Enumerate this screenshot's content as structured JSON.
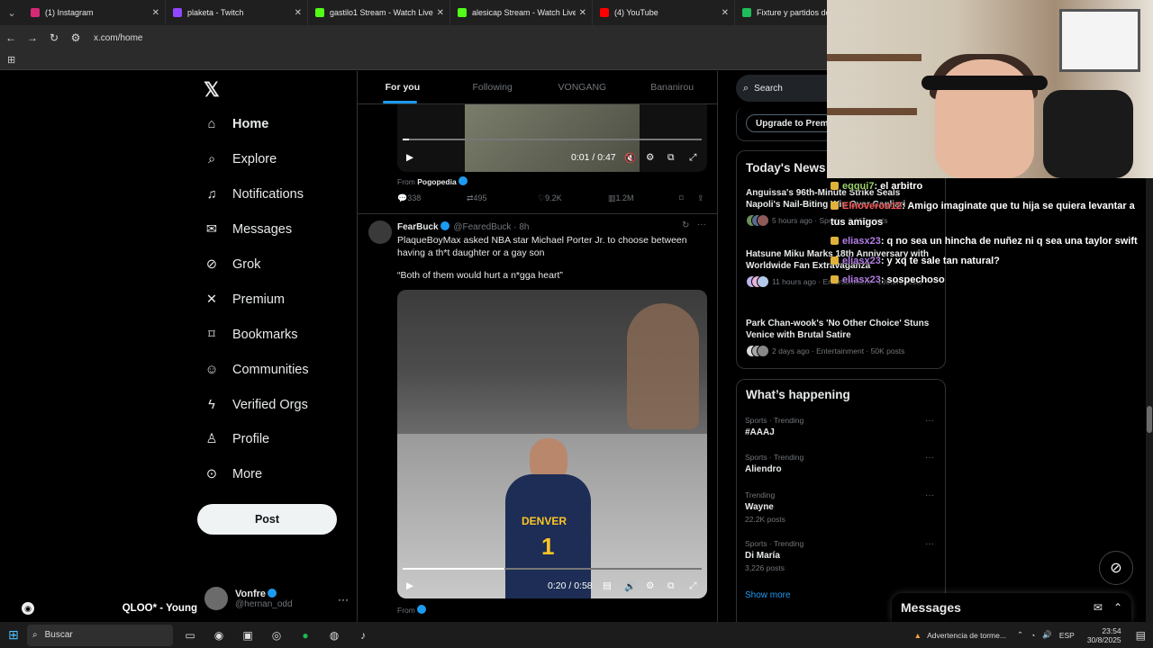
{
  "browser": {
    "tabs": [
      {
        "title": "(1) Instagram",
        "color": "#d62976"
      },
      {
        "title": "plaketa - Twitch",
        "color": "#9146ff"
      },
      {
        "title": "gastilo1 Stream - Watch Live o",
        "color": "#53fc18"
      },
      {
        "title": "alesicap Stream - Watch Live o",
        "color": "#53fc18"
      },
      {
        "title": "(4) YouTube",
        "color": "#ff0000"
      },
      {
        "title": "Fixture y partidos de m",
        "color": "#1fbe5a"
      }
    ],
    "url": "x.com/home"
  },
  "nav": {
    "items": [
      {
        "label": "Home",
        "icon": "home-icon",
        "glyph": "⌂"
      },
      {
        "label": "Explore",
        "icon": "search-icon",
        "glyph": "⌕"
      },
      {
        "label": "Notifications",
        "icon": "bell-icon",
        "glyph": "♫"
      },
      {
        "label": "Messages",
        "icon": "envelope-icon",
        "glyph": "✉"
      },
      {
        "label": "Grok",
        "icon": "grok-icon",
        "glyph": "⊘"
      },
      {
        "label": "Premium",
        "icon": "x-logo-icon",
        "glyph": "✕"
      },
      {
        "label": "Bookmarks",
        "icon": "bookmark-icon",
        "glyph": "⌑"
      },
      {
        "label": "Communities",
        "icon": "people-icon",
        "glyph": "☺"
      },
      {
        "label": "Verified Orgs",
        "icon": "lightning-icon",
        "glyph": "ϟ"
      },
      {
        "label": "Profile",
        "icon": "person-icon",
        "glyph": "♙"
      },
      {
        "label": "More",
        "icon": "more-circle-icon",
        "glyph": "⊙"
      }
    ],
    "post_label": "Post",
    "account": {
      "name": "Vonfre",
      "handle": "@hernan_odd"
    }
  },
  "music": {
    "text": "QLOO* - Young"
  },
  "timeline": {
    "tabs": [
      "For you",
      "Following",
      "VONGANG",
      "Bananirou"
    ],
    "post1": {
      "time": "0:01 / 0:47",
      "progress": 0.02,
      "from_label": "From",
      "from_name": "Pogopedia",
      "stats": {
        "replies": "338",
        "reposts": "495",
        "likes": "9.2K",
        "views": "1.2M"
      }
    },
    "post2": {
      "name": "FearBuck",
      "handle": "@FearedBuck",
      "time": "· 8h",
      "text": "PlaqueBoyMax asked NBA star Michael Porter Jr. to choose between having a th*t daughter or a gay son",
      "quote": "“Both of them would hurt a n*gga heart”",
      "jersey_text": "DENVER",
      "jersey_number": "1",
      "video_time": "0:20 / 0:58",
      "progress": 0.34,
      "from_label": "From"
    }
  },
  "sidebar": {
    "search_placeholder": "Search",
    "premium_button": "Upgrade to Prem",
    "news_title": "Today's News",
    "news": [
      {
        "title": "Anguissa's 96th-Minute Strike Seals Napoli's Nail-Biting Win Over Cagliari",
        "meta": "5 hours ago · Sports · 9,150 posts"
      },
      {
        "title": "Hatsune Miku Marks 18th Anniversary with Worldwide Fan Extravaganza",
        "meta": "11 hours ago · Entertainment · 100.2K posts"
      },
      {
        "title": "Park Chan-wook's 'No Other Choice' Stuns Venice with Brutal Satire",
        "meta": "2 days ago · Entertainment · 50K posts"
      }
    ],
    "happening_title": "What’s happening",
    "trends": [
      {
        "category": "Sports · Trending",
        "name": "#AAAJ",
        "posts": ""
      },
      {
        "category": "Sports · Trending",
        "name": "Aliendro",
        "posts": ""
      },
      {
        "category": "Trending",
        "name": "Wayne",
        "posts": "22.2K posts"
      },
      {
        "category": "Sports · Trending",
        "name": "Di María",
        "posts": "3,226 posts"
      }
    ],
    "show_more": "Show more"
  },
  "chat": [
    {
      "user": "eqqui7",
      "msg": ": el arbitro",
      "color": "#9bd06a"
    },
    {
      "user": "Elnoveron12",
      "msg": ": Amigo imaginate que tu hija se quiera levantar a",
      "color": "#ff5a5a"
    },
    {
      "user": "",
      "msg": "tus amigos",
      "color": "#ffffff"
    },
    {
      "user": "eliasx23",
      "msg": ": q no sea un hincha de nuñez ni q sea una taylor swift",
      "color": "#b57fe6"
    },
    {
      "user": "eliasx23",
      "msg": ": y xq te sale tan natural?",
      "color": "#b57fe6"
    },
    {
      "user": "eliasx23",
      "msg": ": sospechoso",
      "color": "#b57fe6"
    }
  ],
  "messages_dock": {
    "title": "Messages"
  },
  "taskbar": {
    "search_label": "Buscar",
    "weather": "Advertencia de torme...",
    "lang": "ESP",
    "time": "23:54",
    "date": "30/8/2025"
  }
}
